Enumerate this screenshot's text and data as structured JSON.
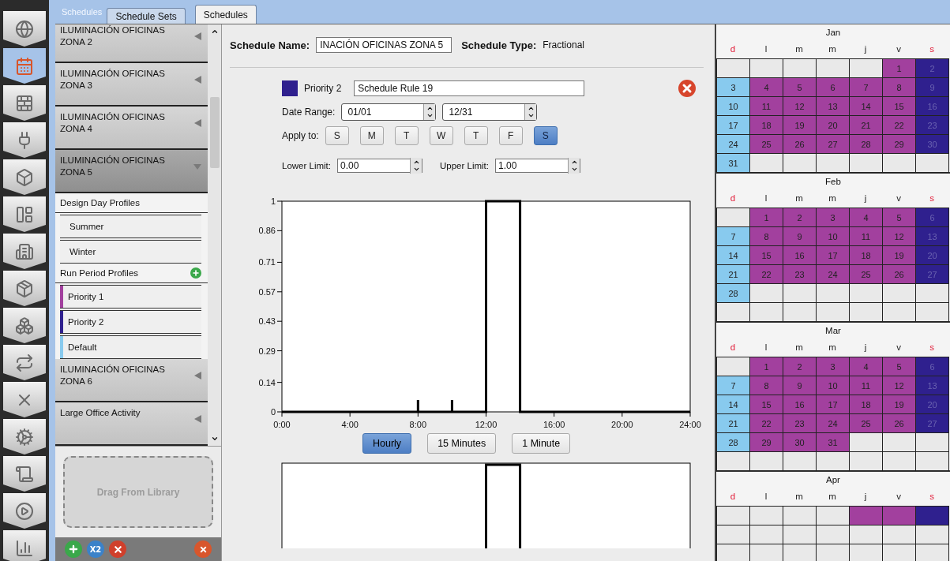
{
  "nav": [
    {
      "selected": false
    },
    {
      "selected": true
    },
    {
      "selected": false
    },
    {
      "selected": false
    },
    {
      "selected": false
    },
    {
      "selected": false
    },
    {
      "selected": false
    },
    {
      "selected": false
    },
    {
      "selected": false
    },
    {
      "selected": false
    },
    {
      "selected": false
    },
    {
      "selected": false
    },
    {
      "selected": false
    },
    {
      "selected": false
    },
    {
      "selected": false
    }
  ],
  "header": {
    "title": "Schedules"
  },
  "tabs": [
    {
      "label": "Schedule Sets",
      "selected": false
    },
    {
      "label": "Schedules",
      "selected": true
    }
  ],
  "sidebar": {
    "items": [
      {
        "label": "ILUMINACIÓN OFICINAS ZONA 2",
        "expanded": false
      },
      {
        "label": "ILUMINACIÓN OFICINAS ZONA 3",
        "expanded": false
      },
      {
        "label": "ILUMINACIÓN OFICINAS ZONA 4",
        "expanded": false
      },
      {
        "label": "ILUMINACIÓN OFICINAS ZONA 5",
        "expanded": true,
        "sections": [
          {
            "label": "Design Day Profiles",
            "profiles": [
              {
                "label": "Summer"
              },
              {
                "label": "Winter"
              }
            ]
          },
          {
            "label": "Run Period Profiles",
            "add": true,
            "profiles": [
              {
                "label": "Priority 1",
                "color": "#a2409e"
              },
              {
                "label": "Priority 2",
                "color": "#2f208e"
              }
            ]
          },
          {
            "profiles": [
              {
                "label": "Default",
                "color": "#88caee"
              }
            ]
          }
        ]
      },
      {
        "label": "ILUMINACIÓN OFICINAS ZONA 6",
        "expanded": false
      },
      {
        "label": "Large Office Activity",
        "expanded": false
      }
    ],
    "drop_zone": "Drag From Library",
    "toolbar": [
      {
        "kind": "add"
      },
      {
        "kind": "copy",
        "label": "X2"
      },
      {
        "kind": "remove"
      },
      {
        "kind": "purge"
      }
    ]
  },
  "schedule": {
    "name_label": "Schedule Name:",
    "name": "INACIÓN OFICINAS ZONA 5",
    "type_label": "Schedule Type:",
    "type": "Fractional"
  },
  "rule": {
    "color": "#2f208e",
    "priority": "Priority 2",
    "name": "Schedule Rule 19",
    "date_range_label": "Date Range:",
    "start": "01/01",
    "end": "12/31",
    "apply_label": "Apply to:",
    "days": [
      {
        "label": "S",
        "selected": false
      },
      {
        "label": "M",
        "selected": false
      },
      {
        "label": "T",
        "selected": false
      },
      {
        "label": "W",
        "selected": false
      },
      {
        "label": "T",
        "selected": false
      },
      {
        "label": "F",
        "selected": false
      },
      {
        "label": "S",
        "selected": true
      }
    ],
    "lower_label": "Lower Limit:",
    "lower": "0.00",
    "upper_label": "Upper Limit:",
    "upper": "1.00"
  },
  "chart_data": {
    "type": "line",
    "x": [
      0,
      8,
      10,
      12,
      12,
      14,
      14,
      24
    ],
    "series": [
      {
        "color": "#000000",
        "values": [
          0,
          0,
          0,
          0,
          1,
          1,
          0,
          0
        ]
      }
    ],
    "xlim": [
      0,
      24
    ],
    "ylim": [
      0,
      1
    ],
    "xticks": [
      {
        "value": 0,
        "label": "0:00"
      },
      {
        "value": 4,
        "label": "4:00"
      },
      {
        "value": 8,
        "label": "8:00"
      },
      {
        "value": 12,
        "label": "12:00"
      },
      {
        "value": 16,
        "label": "16:00"
      },
      {
        "value": 20,
        "label": "20:00"
      },
      {
        "value": 24,
        "label": "24:00"
      }
    ],
    "yticks": [
      0,
      0.14,
      0.29,
      0.43,
      0.57,
      0.71,
      0.86,
      1
    ]
  },
  "resolution_buttons": [
    {
      "label": "Hourly",
      "selected": true
    },
    {
      "label": "15 Minutes",
      "selected": false
    },
    {
      "label": "1 Minute",
      "selected": false
    }
  ],
  "calendar": {
    "months": [
      {
        "name": "Jan",
        "weekdays": [
          {
            "label": "d",
            "weekend": true
          },
          {
            "label": "l",
            "weekend": false
          },
          {
            "label": "m",
            "weekend": false
          },
          {
            "label": "m",
            "weekend": false
          },
          {
            "label": "j",
            "weekend": false
          },
          {
            "label": "v",
            "weekend": false
          },
          {
            "label": "s",
            "weekend": true
          }
        ],
        "weeks": [
          [
            {
              "day": "1",
              "color": "#a2409e"
            },
            {
              "day": "2",
              "color": "#2f208e"
            }
          ],
          [
            {
              "day": "3",
              "color": "#88caee"
            },
            {
              "day": "4",
              "color": "#a2409e"
            },
            {
              "day": "5",
              "color": "#a2409e"
            },
            {
              "day": "6",
              "color": "#a2409e"
            },
            {
              "day": "7",
              "color": "#a2409e"
            },
            {
              "day": "8",
              "color": "#a2409e"
            },
            {
              "day": "9",
              "color": "#2f208e"
            }
          ],
          [
            {
              "day": "10",
              "color": "#88caee"
            },
            {
              "day": "11",
              "color": "#a2409e"
            },
            {
              "day": "12",
              "color": "#a2409e"
            },
            {
              "day": "13",
              "color": "#a2409e"
            },
            {
              "day": "14",
              "color": "#a2409e"
            },
            {
              "day": "15",
              "color": "#a2409e"
            },
            {
              "day": "16",
              "color": "#2f208e"
            }
          ],
          [
            {
              "day": "17",
              "color": "#88caee"
            },
            {
              "day": "18",
              "color": "#a2409e"
            },
            {
              "day": "19",
              "color": "#a2409e"
            },
            {
              "day": "20",
              "color": "#a2409e"
            },
            {
              "day": "21",
              "color": "#a2409e"
            },
            {
              "day": "22",
              "color": "#a2409e"
            },
            {
              "day": "23",
              "color": "#2f208e"
            }
          ],
          [
            {
              "day": "24",
              "color": "#88caee"
            },
            {
              "day": "25",
              "color": "#a2409e"
            },
            {
              "day": "26",
              "color": "#a2409e"
            },
            {
              "day": "27",
              "color": "#a2409e"
            },
            {
              "day": "28",
              "color": "#a2409e"
            },
            {
              "day": "29",
              "color": "#a2409e"
            },
            {
              "day": "30",
              "color": "#2f208e"
            }
          ],
          [
            {
              "day": "31",
              "color": "#88caee"
            }
          ]
        ]
      },
      {
        "name": "Feb",
        "weekdays": [
          {
            "label": "d",
            "weekend": true
          },
          {
            "label": "l",
            "weekend": false
          },
          {
            "label": "m",
            "weekend": false
          },
          {
            "label": "m",
            "weekend": false
          },
          {
            "label": "j",
            "weekend": false
          },
          {
            "label": "v",
            "weekend": false
          },
          {
            "label": "s",
            "weekend": true
          }
        ],
        "weeks": [
          [
            {
              "day": "1",
              "color": "#a2409e"
            },
            {
              "day": "2",
              "color": "#a2409e"
            },
            {
              "day": "3",
              "color": "#a2409e"
            },
            {
              "day": "4",
              "color": "#a2409e"
            },
            {
              "day": "5",
              "color": "#a2409e"
            },
            {
              "day": "6",
              "color": "#2f208e"
            }
          ],
          [
            {
              "day": "7",
              "color": "#88caee"
            },
            {
              "day": "8",
              "color": "#a2409e"
            },
            {
              "day": "9",
              "color": "#a2409e"
            },
            {
              "day": "10",
              "color": "#a2409e"
            },
            {
              "day": "11",
              "color": "#a2409e"
            },
            {
              "day": "12",
              "color": "#a2409e"
            },
            {
              "day": "13",
              "color": "#2f208e"
            }
          ],
          [
            {
              "day": "14",
              "color": "#88caee"
            },
            {
              "day": "15",
              "color": "#a2409e"
            },
            {
              "day": "16",
              "color": "#a2409e"
            },
            {
              "day": "17",
              "color": "#a2409e"
            },
            {
              "day": "18",
              "color": "#a2409e"
            },
            {
              "day": "19",
              "color": "#a2409e"
            },
            {
              "day": "20",
              "color": "#2f208e"
            }
          ],
          [
            {
              "day": "21",
              "color": "#88caee"
            },
            {
              "day": "22",
              "color": "#a2409e"
            },
            {
              "day": "23",
              "color": "#a2409e"
            },
            {
              "day": "24",
              "color": "#a2409e"
            },
            {
              "day": "25",
              "color": "#a2409e"
            },
            {
              "day": "26",
              "color": "#a2409e"
            },
            {
              "day": "27",
              "color": "#2f208e"
            }
          ],
          [
            {
              "day": "28",
              "color": "#88caee"
            }
          ]
        ]
      },
      {
        "name": "Mar",
        "weekdays": [
          {
            "label": "d",
            "weekend": true
          },
          {
            "label": "l",
            "weekend": false
          },
          {
            "label": "m",
            "weekend": false
          },
          {
            "label": "m",
            "weekend": false
          },
          {
            "label": "j",
            "weekend": false
          },
          {
            "label": "v",
            "weekend": false
          },
          {
            "label": "s",
            "weekend": true
          }
        ],
        "weeks": [
          [
            {
              "day": "1",
              "color": "#a2409e"
            },
            {
              "day": "2",
              "color": "#a2409e"
            },
            {
              "day": "3",
              "color": "#a2409e"
            },
            {
              "day": "4",
              "color": "#a2409e"
            },
            {
              "day": "5",
              "color": "#a2409e"
            },
            {
              "day": "6",
              "color": "#2f208e"
            }
          ],
          [
            {
              "day": "7",
              "color": "#88caee"
            },
            {
              "day": "8",
              "color": "#a2409e"
            },
            {
              "day": "9",
              "color": "#a2409e"
            },
            {
              "day": "10",
              "color": "#a2409e"
            },
            {
              "day": "11",
              "color": "#a2409e"
            },
            {
              "day": "12",
              "color": "#a2409e"
            },
            {
              "day": "13",
              "color": "#2f208e"
            }
          ],
          [
            {
              "day": "14",
              "color": "#88caee"
            },
            {
              "day": "15",
              "color": "#a2409e"
            },
            {
              "day": "16",
              "color": "#a2409e"
            },
            {
              "day": "17",
              "color": "#a2409e"
            },
            {
              "day": "18",
              "color": "#a2409e"
            },
            {
              "day": "19",
              "color": "#a2409e"
            },
            {
              "day": "20",
              "color": "#2f208e"
            }
          ],
          [
            {
              "day": "21",
              "color": "#88caee"
            },
            {
              "day": "22",
              "color": "#a2409e"
            },
            {
              "day": "23",
              "color": "#a2409e"
            },
            {
              "day": "24",
              "color": "#a2409e"
            },
            {
              "day": "25",
              "color": "#a2409e"
            },
            {
              "day": "26",
              "color": "#a2409e"
            },
            {
              "day": "27",
              "color": "#2f208e"
            }
          ],
          [
            {
              "day": "28",
              "color": "#88caee"
            },
            {
              "day": "29",
              "color": "#a2409e"
            },
            {
              "day": "30",
              "color": "#a2409e"
            },
            {
              "day": "31",
              "color": "#a2409e"
            }
          ]
        ]
      },
      {
        "name": "Apr",
        "weekdays": [
          {
            "label": "d",
            "weekend": true
          },
          {
            "label": "l",
            "weekend": false
          },
          {
            "label": "m",
            "weekend": false
          },
          {
            "label": "m",
            "weekend": false
          },
          {
            "label": "j",
            "weekend": false
          },
          {
            "label": "v",
            "weekend": false
          },
          {
            "label": "s",
            "weekend": true
          }
        ],
        "weeks": [
          [
            {
              "color": "#a2409e"
            },
            {
              "color": "#a2409e"
            },
            {
              "color": "#2f208e"
            }
          ]
        ]
      }
    ]
  }
}
